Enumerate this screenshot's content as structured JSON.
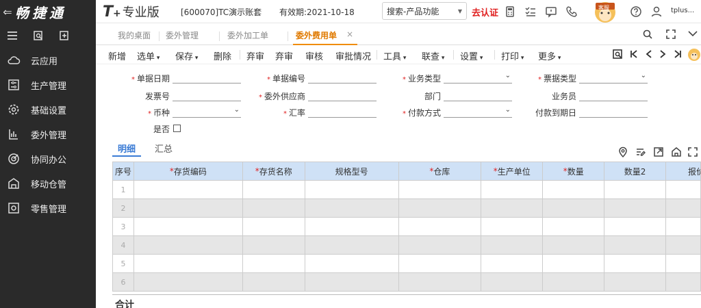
{
  "brand": {
    "back_glyph": "⇐",
    "logo": "畅捷通"
  },
  "product": {
    "t": "T",
    "plus": "+",
    "name": "专业版"
  },
  "account": "[600070]TC演示账套",
  "validity": "有效期:2021-10-18",
  "search": {
    "placeholder": "搜索-产品功能"
  },
  "auth_label": "去认证",
  "user_label": "tplus...",
  "mascot_tag": "客服",
  "tabs": {
    "items": [
      "我的桌面",
      "委外管理",
      "委外加工单",
      "委外费用单"
    ],
    "close": "×"
  },
  "toolbar": {
    "items": [
      "新增",
      "选单",
      "保存",
      "删除",
      "弃审",
      "弃审",
      "审核",
      "审批情况",
      "工具",
      "联查",
      "设置",
      "打印",
      "更多"
    ],
    "dropdown_indices": [
      1,
      2,
      8,
      9,
      10,
      11,
      12
    ]
  },
  "sidebar": {
    "items": [
      "云应用",
      "生产管理",
      "基础设置",
      "委外管理",
      "协同办公",
      "移动仓管",
      "零售管理"
    ]
  },
  "form": {
    "doc_date": "单据日期",
    "doc_no": "单据编号",
    "biz_type": "业务类型",
    "bill_type": "票据类型",
    "invoice_no": "发票号",
    "supplier": "委外供应商",
    "dept": "部门",
    "salesman": "业务员",
    "currency": "币种",
    "rate": "汇率",
    "pay_method": "付款方式",
    "due_date": "付款到期日",
    "yes_no": "是否",
    "required_mark": "*"
  },
  "detail_tabs": [
    "明细",
    "汇总"
  ],
  "grid": {
    "headers": [
      {
        "label": "序号",
        "required": false
      },
      {
        "label": "存货编码",
        "required": true
      },
      {
        "label": "存货名称",
        "required": true
      },
      {
        "label": "规格型号",
        "required": false
      },
      {
        "label": "仓库",
        "required": true
      },
      {
        "label": "生产单位",
        "required": true
      },
      {
        "label": "数量",
        "required": true
      },
      {
        "label": "数量2",
        "required": false
      },
      {
        "label": "报价",
        "required": false
      }
    ],
    "row_numbers": [
      "1",
      "2",
      "3",
      "4",
      "5",
      "6"
    ]
  },
  "footer_label": "合计"
}
